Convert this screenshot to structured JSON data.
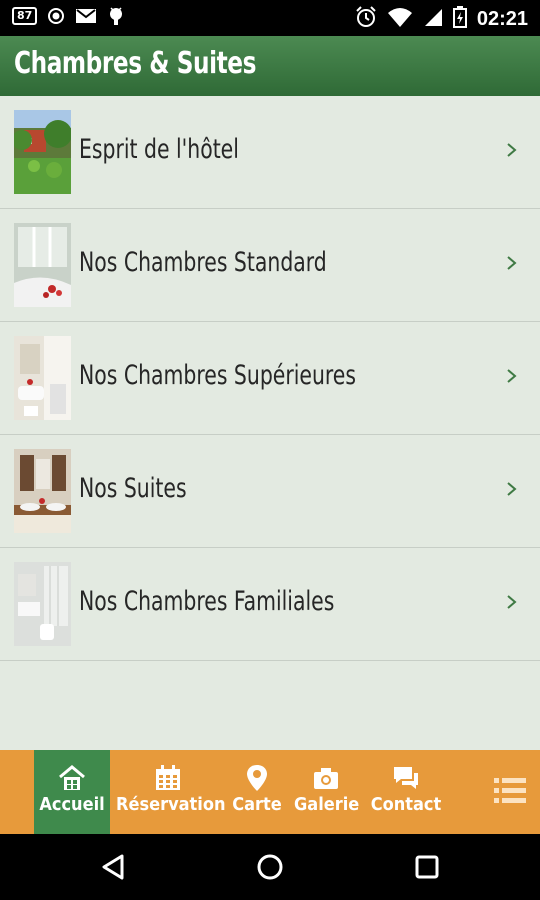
{
  "status_bar": {
    "notification_badge": "87",
    "time": "02:21",
    "icons": [
      "notification-badge-icon",
      "record-icon",
      "gmail-icon",
      "android-icon",
      "alarm-icon",
      "wifi-icon",
      "signal-icon",
      "battery-charging-icon"
    ]
  },
  "header": {
    "title": "Chambres & Suites"
  },
  "list": {
    "items": [
      {
        "label": "Esprit de l'hôtel",
        "thumb": "garden-thumb"
      },
      {
        "label": "Nos Chambres Standard",
        "thumb": "bathroom-thumb"
      },
      {
        "label": "Nos Chambres Supérieures",
        "thumb": "bathroom-thumb"
      },
      {
        "label": "Nos Suites",
        "thumb": "sink-thumb"
      },
      {
        "label": "Nos Chambres Familiales",
        "thumb": "bathroom-thumb"
      }
    ]
  },
  "tabbar": {
    "tabs": [
      {
        "label": "Accueil",
        "icon": "home-icon",
        "active": true
      },
      {
        "label": "Réservation",
        "icon": "calendar-icon",
        "active": false
      },
      {
        "label": "Carte",
        "icon": "map-pin-icon",
        "active": false
      },
      {
        "label": "Galerie",
        "icon": "camera-icon",
        "active": false
      },
      {
        "label": "Contact",
        "icon": "chat-icon",
        "active": false
      }
    ],
    "menu_icon": "list-menu-icon"
  },
  "navbar": {
    "icons": [
      "back-icon",
      "home-circle-icon",
      "recents-icon"
    ]
  },
  "colors": {
    "header_green": "#2f6a36",
    "tab_orange": "#e79a3b",
    "tab_active_green": "#3f8a4c",
    "list_background": "#e3eae1",
    "chevron_green": "#3f7a44"
  }
}
